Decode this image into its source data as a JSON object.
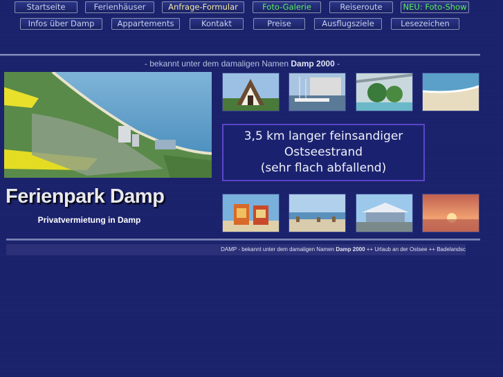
{
  "nav": {
    "row1": [
      {
        "label": "Startseite",
        "color": "#c8d0ee"
      },
      {
        "label": "Ferienhäuser",
        "color": "#c8d0ee"
      },
      {
        "label": "Anfrage-Formular",
        "color": "#f4e9a8"
      },
      {
        "label": "Foto-Galerie",
        "color": "#5cf05c"
      },
      {
        "label": "Reiseroute",
        "color": "#c8d0ee"
      },
      {
        "label": "NEU: Foto-Show",
        "color": "#5cf05c"
      }
    ],
    "row2": [
      {
        "label": "Infos über Damp"
      },
      {
        "label": "Appartements"
      },
      {
        "label": "Kontakt"
      },
      {
        "label": "Preise"
      },
      {
        "label": "Ausflugsziele"
      },
      {
        "label": "Lesezeichen"
      }
    ]
  },
  "subtitle": {
    "prefix": "- bekannt unter dem damaligen Namen",
    "name": "Damp 2000",
    "suffix": "-"
  },
  "infobox": {
    "line1": "3,5 km langer feinsandiger",
    "line2": "Ostseestrand",
    "line3": "(sehr flach abfallend)"
  },
  "brand": {
    "title": "Ferienpark Damp",
    "tagline": "Privatvermietung in Damp"
  },
  "ticker": {
    "text1": "DAMP - bekannt unter dem damaligen Namen",
    "name": "Damp 2000",
    "text2": "++ Urlaub an der Ostsee ++ Badelandsc"
  },
  "colors": {
    "background": "#1c2470",
    "infobox_border": "#5a46c8",
    "highlight_green": "#5cf05c",
    "highlight_yellow": "#f4e9a8"
  }
}
